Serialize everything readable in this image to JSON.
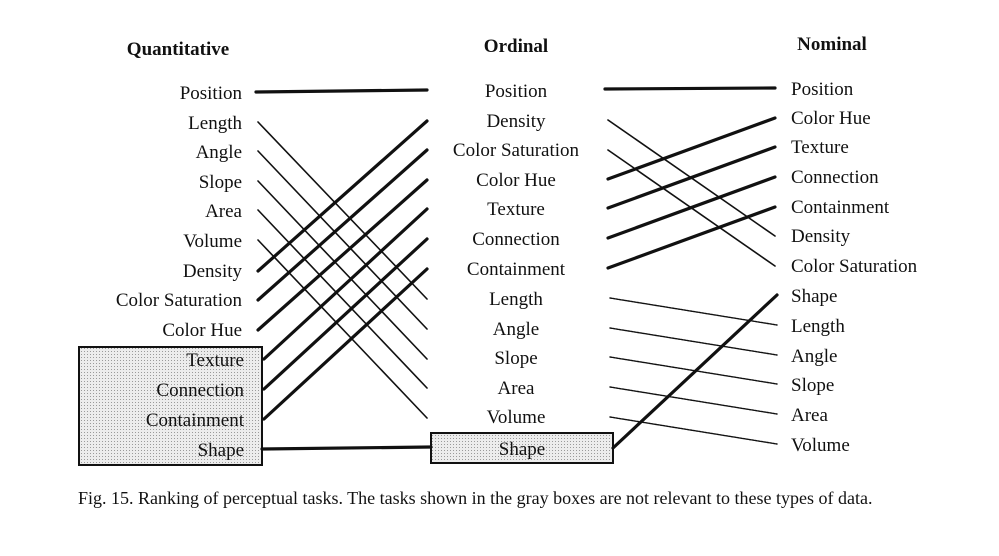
{
  "columns": [
    {
      "header": "Quantitative",
      "items": [
        "Position",
        "Length",
        "Angle",
        "Slope",
        "Area",
        "Volume",
        "Density",
        "Color Saturation",
        "Color Hue",
        "Texture",
        "Connection",
        "Containment",
        "Shape"
      ],
      "gray": [
        "Texture",
        "Connection",
        "Containment",
        "Shape"
      ]
    },
    {
      "header": "Ordinal",
      "items": [
        "Position",
        "Density",
        "Color Saturation",
        "Color Hue",
        "Texture",
        "Connection",
        "Containment",
        "Length",
        "Angle",
        "Slope",
        "Area",
        "Volume",
        "Shape"
      ],
      "gray": [
        "Shape"
      ]
    },
    {
      "header": "Nominal",
      "items": [
        "Position",
        "Color Hue",
        "Texture",
        "Connection",
        "Containment",
        "Density",
        "Color Saturation",
        "Shape",
        "Length",
        "Angle",
        "Slope",
        "Area",
        "Volume"
      ],
      "gray": []
    }
  ],
  "relevant_lines": [
    "Position",
    "Density",
    "Color Saturation",
    "Color Hue",
    "Texture",
    "Connection",
    "Containment",
    "Shape"
  ],
  "caption": "Fig. 15.   Ranking of perceptual tasks. The tasks shown in the gray boxes are not relevant to these types of data.",
  "colors": {
    "ink": "#111111",
    "gray_box": "#d9d9d9"
  }
}
